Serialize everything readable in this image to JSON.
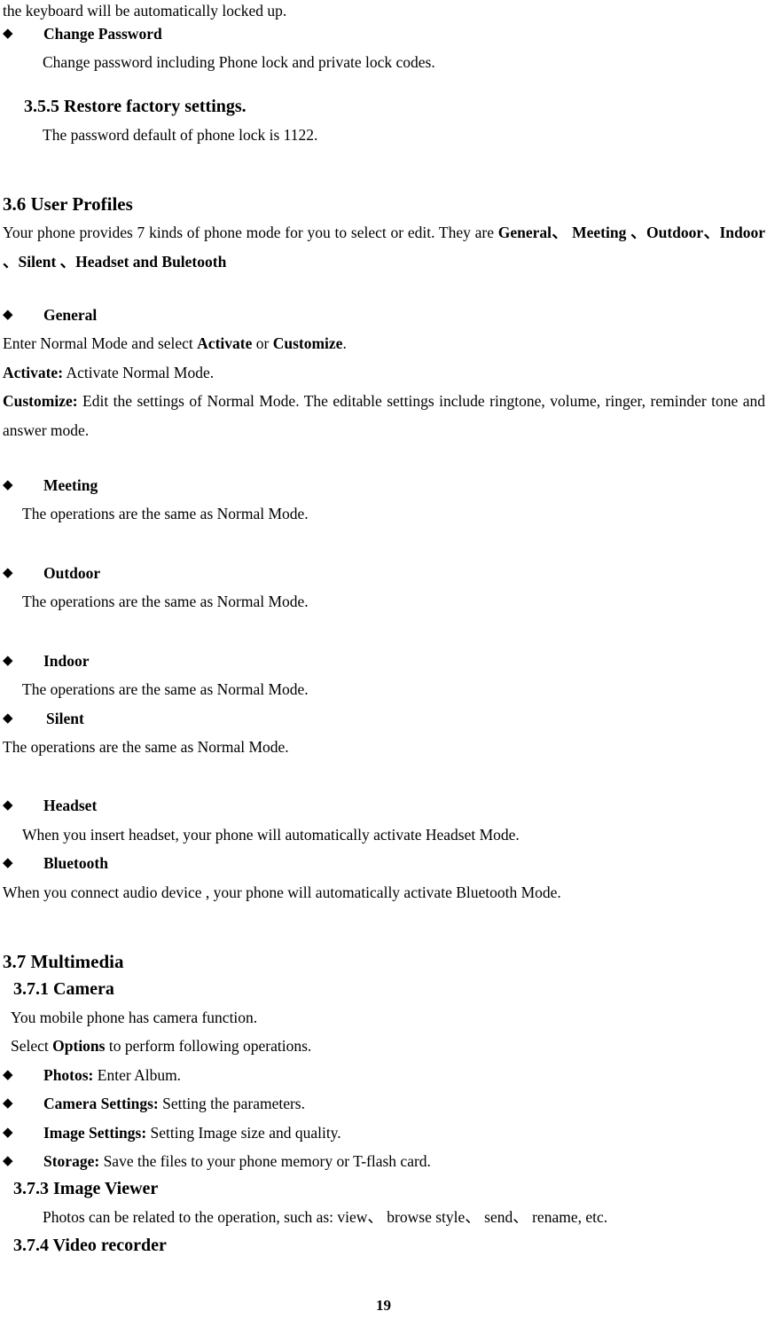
{
  "document": {
    "page_number": "19",
    "bullet_glyph": "◆"
  },
  "continuation_line": "the keyboard will be automatically locked up.",
  "change_password": {
    "heading": "Change Password",
    "body": "Change password including Phone lock and private lock codes."
  },
  "section_355": {
    "heading": "3.5.5 Restore factory settings.",
    "body": "The password default of phone lock is 1122."
  },
  "section_36": {
    "heading": "3.6 User Profiles",
    "intro_plain_1": "Your phone provides 7 kinds of phone mode for you to select or edit. They are ",
    "intro_bold_1": "General、",
    "intro_bold_2": "Meeting 、Outdoor、Indoor 、Silent 、Headset and Buletooth",
    "profiles": [
      {
        "name": "General",
        "lines": [
          {
            "plain_1": "Enter Normal Mode and select ",
            "bold_1": "Activate",
            "plain_2": " or ",
            "bold_2": "Customize",
            "plain_3": "."
          },
          {
            "bold_1": "Activate:",
            "plain_1": " Activate Normal Mode."
          },
          {
            "bold_1": "Customize:",
            "plain_1": " Edit the settings of Normal Mode. The editable settings include ringtone, volume, ringer, reminder tone and answer mode."
          }
        ]
      },
      {
        "name": "Meeting",
        "body": "The operations are the same as Normal Mode."
      },
      {
        "name": "Outdoor",
        "body": "The operations are the same as Normal Mode."
      },
      {
        "name": "Indoor",
        "body": "The operations are the same as Normal Mode."
      },
      {
        "name": "Silent",
        "body": "The operations are the same as Normal Mode."
      },
      {
        "name": "Headset",
        "body": "When you insert headset, your phone will automatically activate Headset Mode."
      },
      {
        "name": "Bluetooth",
        "body": "When you connect audio device , your phone will automatically activate Bluetooth Mode."
      }
    ]
  },
  "section_37": {
    "heading": "3.7 Multimedia",
    "camera": {
      "heading": "3.7.1 Camera",
      "line_1": "You mobile phone has camera function.",
      "line_2_plain_1": "Select ",
      "line_2_bold_1": "Options",
      "line_2_plain_2": " to perform following operations.",
      "options": [
        {
          "label": "Photos:",
          "desc": " Enter Album."
        },
        {
          "label": "Camera Settings:",
          "desc": " Setting the parameters."
        },
        {
          "label": "Image Settings:",
          "desc": " Setting Image size and quality."
        },
        {
          "label": "Storage:",
          "desc": " Save the files to your phone memory or T-flash card."
        }
      ]
    },
    "image_viewer": {
      "heading": "3.7.3 Image Viewer",
      "body": "Photos can be related to the operation, such as: view、 browse style、 send、 rename, etc."
    },
    "video_recorder": {
      "heading": "3.7.4 Video recorder"
    }
  }
}
